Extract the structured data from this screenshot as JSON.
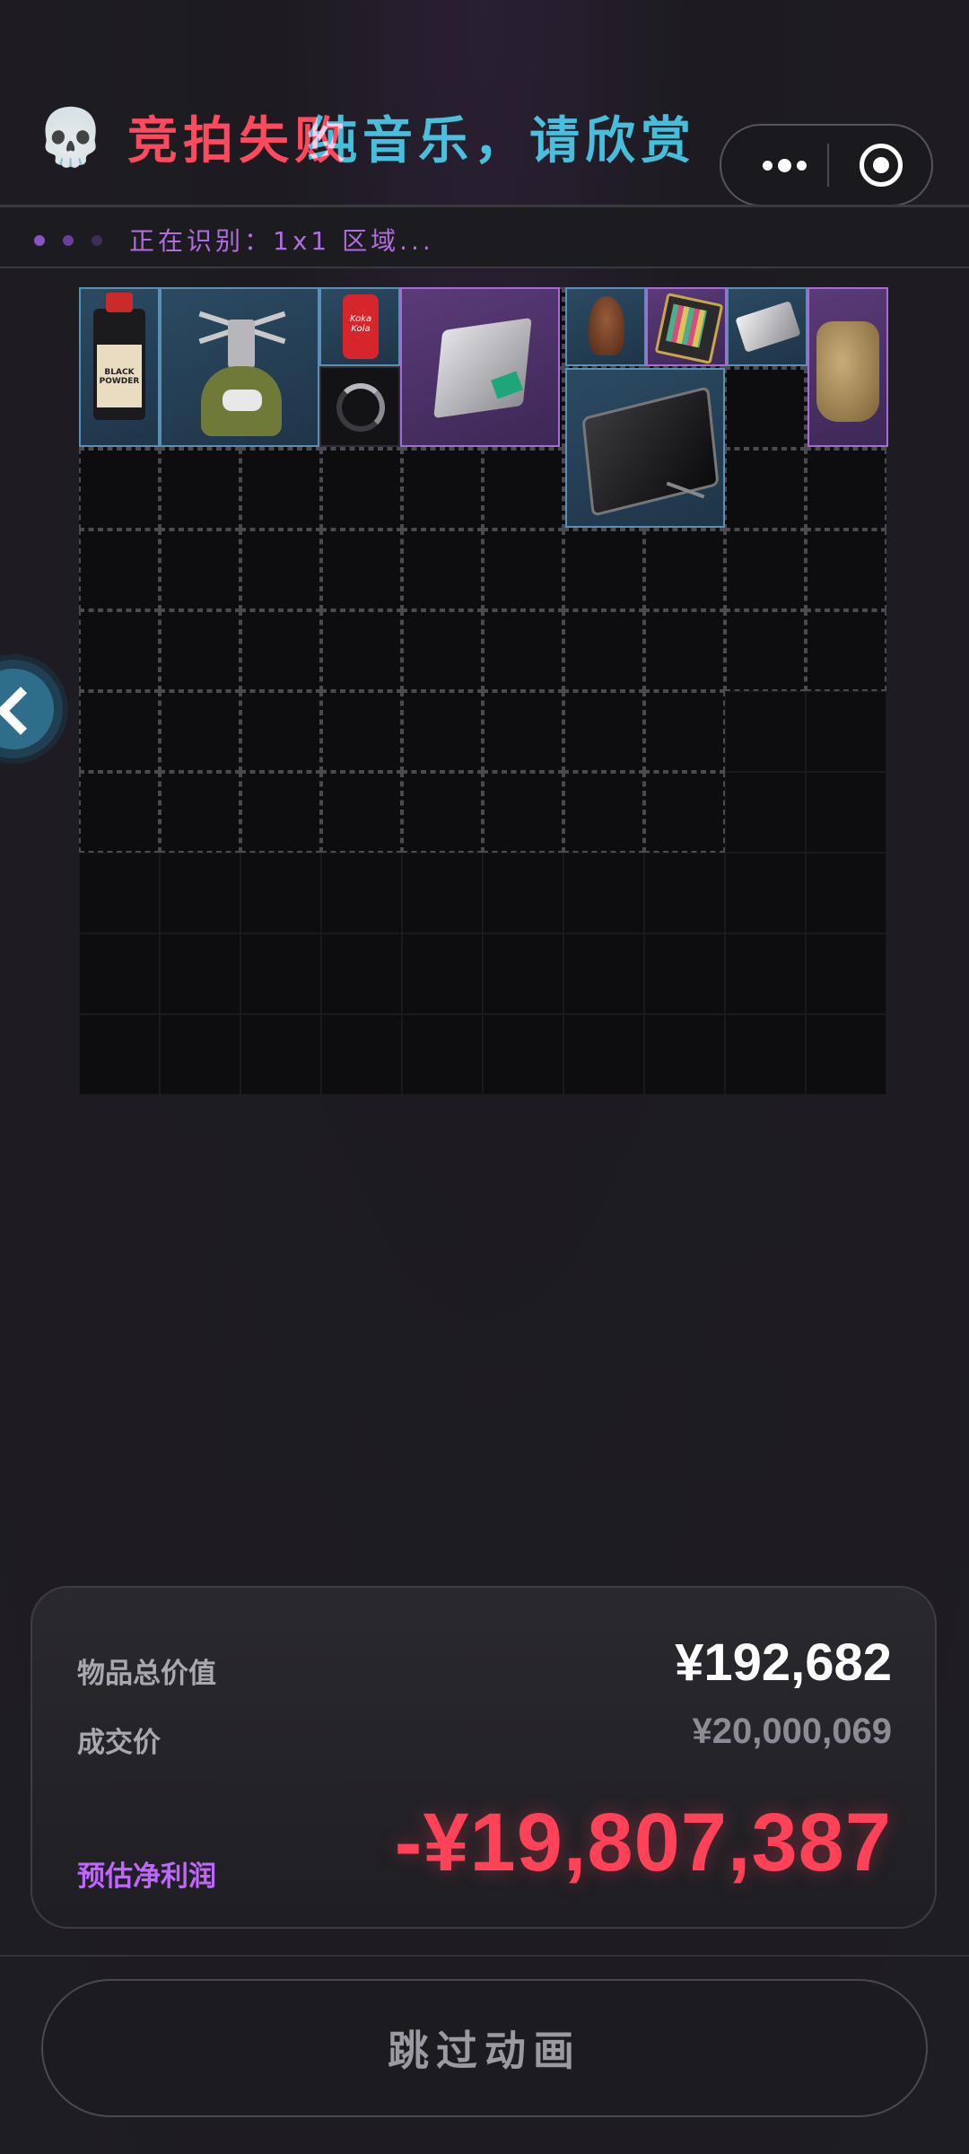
{
  "header": {
    "title_part1": "竞拍失败",
    "title_part2": "纯音乐，请欣赏",
    "skull_glyph": "💀"
  },
  "status": {
    "text": "正在识别：1x1  区域..."
  },
  "grid": {
    "columns": 10,
    "rows": 10
  },
  "items": [
    {
      "name": "black-powder-bottle",
      "label": "BLACK POWDER",
      "rarity": "blue"
    },
    {
      "name": "camping-stove",
      "rarity": "blue"
    },
    {
      "name": "cola-can",
      "label": "Koka Kola",
      "rarity": "blue"
    },
    {
      "name": "loading-slot",
      "rarity": "empty"
    },
    {
      "name": "router-box",
      "rarity": "purple"
    },
    {
      "name": "bird-figurine",
      "rarity": "blue"
    },
    {
      "name": "circuit-chip",
      "rarity": "purple"
    },
    {
      "name": "metal-sheet",
      "rarity": "blue"
    },
    {
      "name": "canvas-bag",
      "rarity": "purple"
    },
    {
      "name": "tablet-screen",
      "rarity": "blue"
    }
  ],
  "summary": {
    "total_label": "物品总价值",
    "total_value": "¥192,682",
    "deal_label": "成交价",
    "deal_value": "¥20,000,069",
    "profit_label": "预估净利润",
    "profit_value": "-¥19,807,387"
  },
  "skip_button": {
    "label": "跳过动画"
  },
  "colors": {
    "loss_red": "#ff4258",
    "profit_purple": "#c066ff",
    "rarity_blue": "#5a8fb6",
    "rarity_purple": "#a86ad6"
  }
}
